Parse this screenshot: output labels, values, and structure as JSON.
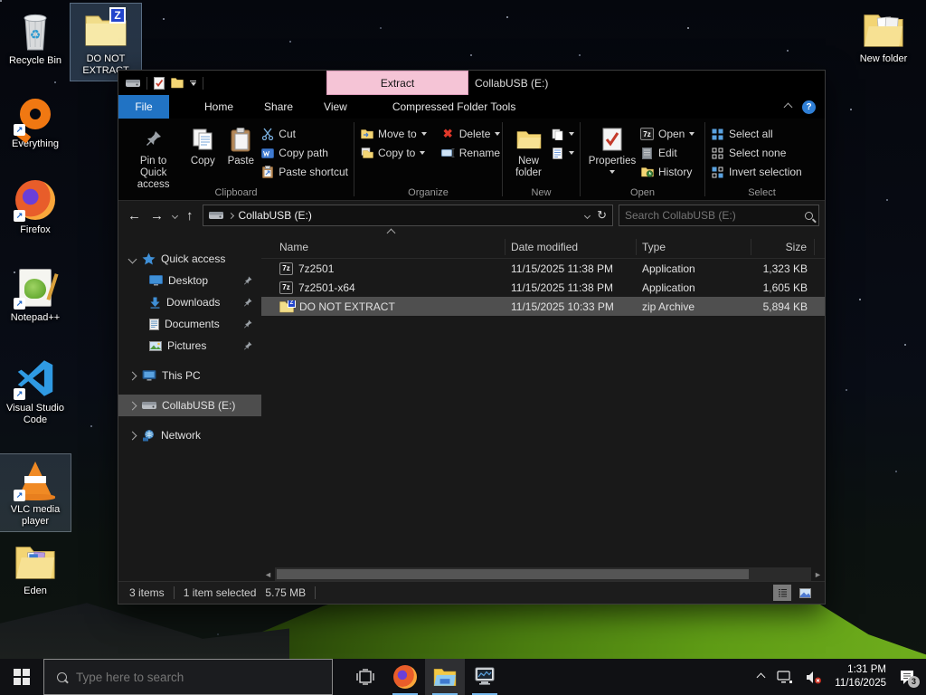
{
  "desktop": {
    "icons": [
      {
        "label": "Recycle Bin"
      },
      {
        "label": "DO NOT EXTRACT"
      },
      {
        "label": "Everything"
      },
      {
        "label": "Firefox"
      },
      {
        "label": "Notepad++"
      },
      {
        "label": "Visual Studio Code"
      },
      {
        "label": "VLC media player"
      },
      {
        "label": "Eden"
      },
      {
        "label": "New folder"
      }
    ]
  },
  "explorer": {
    "title": "CollabUSB (E:)",
    "context_tab": "Extract",
    "tabs": [
      {
        "label": "File"
      },
      {
        "label": "Home"
      },
      {
        "label": "Share"
      },
      {
        "label": "View"
      },
      {
        "label": "Compressed Folder Tools"
      }
    ],
    "ribbon": {
      "clipboard": {
        "label": "Clipboard",
        "pin": "Pin to Quick access",
        "copy": "Copy",
        "paste": "Paste",
        "cut": "Cut",
        "copy_path": "Copy path",
        "paste_shortcut": "Paste shortcut"
      },
      "organize": {
        "label": "Organize",
        "move_to": "Move to",
        "copy_to": "Copy to",
        "delete": "Delete",
        "rename": "Rename"
      },
      "new_group": {
        "label": "New",
        "new_folder": "New folder"
      },
      "open_group": {
        "label": "Open",
        "properties": "Properties",
        "open": "Open",
        "edit": "Edit",
        "history": "History"
      },
      "select_group": {
        "label": "Select",
        "select_all": "Select all",
        "select_none": "Select none",
        "invert": "Invert selection"
      }
    },
    "address": {
      "breadcrumb": "CollabUSB (E:)",
      "search_placeholder": "Search CollabUSB (E:)"
    },
    "nav": {
      "items": [
        {
          "label": "Quick access"
        },
        {
          "label": "Desktop"
        },
        {
          "label": "Downloads"
        },
        {
          "label": "Documents"
        },
        {
          "label": "Pictures"
        },
        {
          "label": "This PC"
        },
        {
          "label": "CollabUSB (E:)"
        },
        {
          "label": "Network"
        }
      ]
    },
    "list": {
      "headers": [
        {
          "label": "Name"
        },
        {
          "label": "Date modified"
        },
        {
          "label": "Type"
        },
        {
          "label": "Size"
        }
      ],
      "rows": [
        {
          "name": "7z2501",
          "modified": "11/15/2025 11:38 PM",
          "type": "Application",
          "size": "1,323 KB",
          "icon": "7z-installer",
          "selected": false
        },
        {
          "name": "7z2501-x64",
          "modified": "11/15/2025 11:38 PM",
          "type": "Application",
          "size": "1,605 KB",
          "icon": "7z-installer",
          "selected": false
        },
        {
          "name": "DO NOT EXTRACT",
          "modified": "11/15/2025 10:33 PM",
          "type": "zip Archive",
          "size": "5,894 KB",
          "icon": "zip-archive",
          "selected": true
        }
      ]
    },
    "status": {
      "items": "3 items",
      "selection": "1 item selected",
      "selection_size": "5.75 MB"
    }
  },
  "taskbar": {
    "search_placeholder": "Type here to search",
    "clock": {
      "time": "1:31 PM",
      "date": "11/16/2025"
    },
    "notifications_badge": "3"
  },
  "colors": {
    "accent_blue": "#2173c4",
    "context_tab_pink": "#f5c4d6",
    "selection_gray": "#4f4f4f",
    "folder_yellow": "#f7d366"
  }
}
